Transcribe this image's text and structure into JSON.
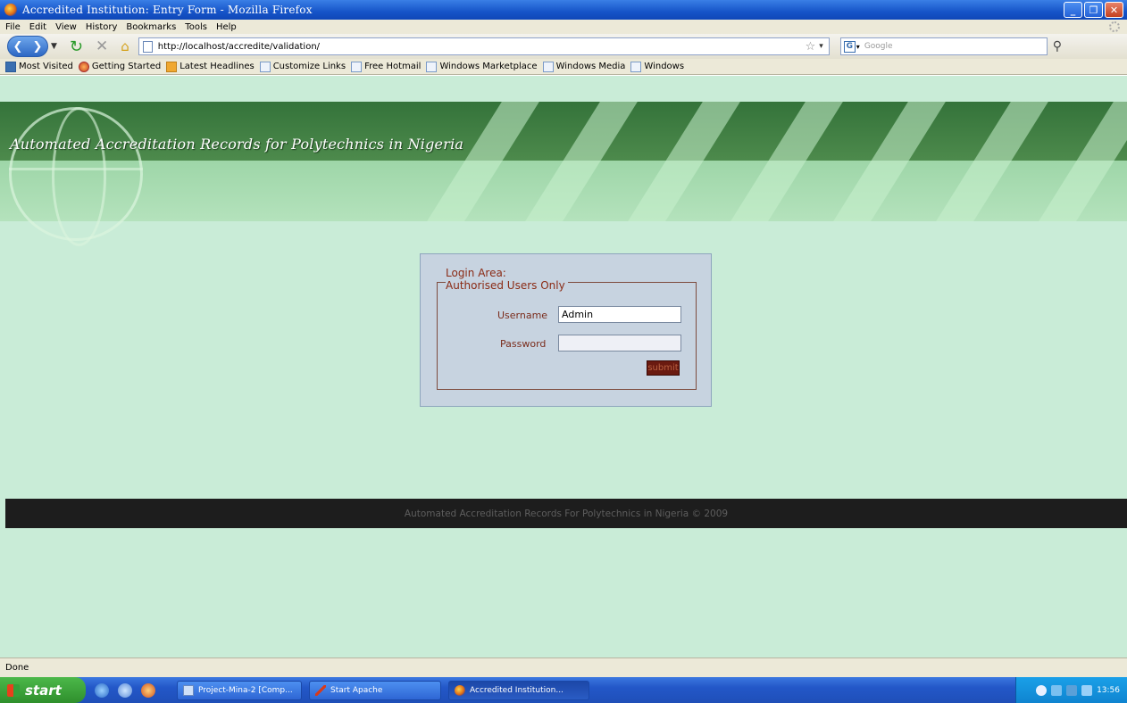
{
  "window": {
    "title": "Accredited Institution: Entry Form - Mozilla Firefox",
    "minimize": "_",
    "maximize": "❐",
    "close": "✕"
  },
  "menu": [
    "File",
    "Edit",
    "View",
    "History",
    "Bookmarks",
    "Tools",
    "Help"
  ],
  "toolbar": {
    "url": "http://localhost/accredite/validation/",
    "search_placeholder": "Google"
  },
  "bookmarks": [
    {
      "label": "Most Visited",
      "icon": "folder-icon"
    },
    {
      "label": "Getting Started",
      "icon": "firefox-icon"
    },
    {
      "label": "Latest Headlines",
      "icon": "rss-folder-icon"
    },
    {
      "label": "Customize Links",
      "icon": "page-icon"
    },
    {
      "label": "Free Hotmail",
      "icon": "page-icon"
    },
    {
      "label": "Windows Marketplace",
      "icon": "page-icon"
    },
    {
      "label": "Windows Media",
      "icon": "page-icon"
    },
    {
      "label": "Windows",
      "icon": "page-icon"
    }
  ],
  "page": {
    "banner_title": "Automated Accreditation Records for Polytechnics in Nigeria",
    "login": {
      "legend_line1": "Login Area:",
      "legend_line2": "Authorised Users Only",
      "username_label": "Username",
      "username_value": "Admin",
      "password_label": "Password",
      "password_value": "",
      "submit_label": "submit"
    },
    "footer": "Automated Accreditation Records For Polytechnics in Nigeria © 2009"
  },
  "status": {
    "text": "Done"
  },
  "taskbar": {
    "start_label": "start",
    "tasks": [
      {
        "label": "Project-Mina-2 [Comp...",
        "active": false
      },
      {
        "label": "Start Apache",
        "active": false
      },
      {
        "label": "Accredited Institution...",
        "active": true
      }
    ],
    "clock": "13:56"
  },
  "colors": {
    "banner_dark": "#34733a",
    "page_bg": "#c9ecd7",
    "login_bg": "#c7d3e0",
    "label_color": "#7a2c1c",
    "footer_bg": "#1d1d1d"
  }
}
